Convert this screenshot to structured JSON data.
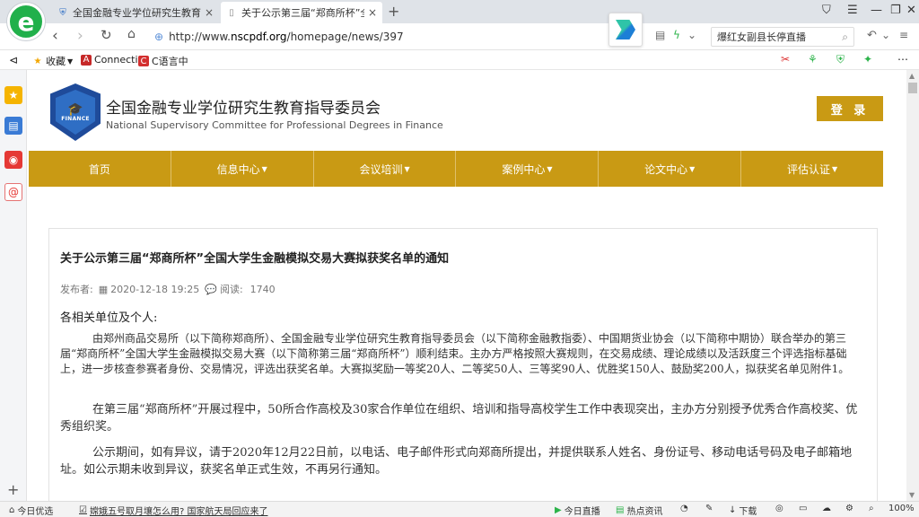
{
  "browser": {
    "logo_letter": "e",
    "tabs": [
      {
        "title": "全国金融专业学位研究生教育指导",
        "active": false
      },
      {
        "title": "关于公示第三届“郑商所杯”全国大",
        "active": true
      }
    ],
    "url_prefix": "http://www.",
    "url_domain": "nscpdf.org",
    "url_path": "/homepage/news/397",
    "search_text": "爆红女副县长停直播"
  },
  "bookmarks": [
    {
      "label": "收藏"
    },
    {
      "label": "Connecti"
    },
    {
      "label": "C语言中"
    }
  ],
  "site": {
    "logo_word": "FINANCE",
    "title_cn": "全国金融专业学位研究生教育指导委员会",
    "title_en": "National Supervisory Committee for Professional Degrees in Finance",
    "login": "登 录",
    "nav": [
      {
        "label": "首页",
        "dropdown": false
      },
      {
        "label": "信息中心",
        "dropdown": true
      },
      {
        "label": "会议培训",
        "dropdown": true
      },
      {
        "label": "案例中心",
        "dropdown": true
      },
      {
        "label": "论文中心",
        "dropdown": true
      },
      {
        "label": "评估认证",
        "dropdown": true
      }
    ]
  },
  "article": {
    "title": "关于公示第三届“郑商所杯”全国大学生金融模拟交易大赛拟获奖名单的通知",
    "publisher_label": "发布者:",
    "date": "2020-12-18 19:25",
    "views_label": "阅读:",
    "views": "1740",
    "salutation": "各相关单位及个人:",
    "paragraphs": [
      "由郑州商品交易所（以下简称郑商所）、全国金融专业学位研究生教育指导委员会（以下简称金融教指委）、中国期货业协会（以下简称中期协）联合举办的第三届“郑商所杯”全国大学生金融模拟交易大赛（以下简称第三届“郑商所杯”）顺利结束。主办方严格按照大赛规则，在交易成绩、理论成绩以及活跃度三个评选指标基础上，进一步核查参赛者身份、交易情况，评选出获奖名单。大赛拟奖励一等奖20人、二等奖50人、三等奖90人、优胜奖150人、鼓励奖200人，拟获奖名单见附件1。",
      "在第三届“郑商所杯”开展过程中，50所合作高校及30家合作单位在组织、培训和指导高校学生工作中表现突出，主办方分别授予优秀合作高校奖、优秀组织奖。",
      "公示期间，如有异议，请于2020年12月22日前，以电话、电子邮件形式向郑商所提出，并提供联系人姓名、身份证号、移动电话号码及电子邮箱地址。如公示期未收到异议，获奖名单正式生效，不再另行通知。"
    ]
  },
  "statusbar": {
    "left1": "今日优选",
    "news": "嫦娥五号取月壤怎么用? 国家航天局回应来了",
    "live": "今日直播",
    "hot": "热点资讯",
    "download": "下载",
    "zoom": "100%"
  }
}
